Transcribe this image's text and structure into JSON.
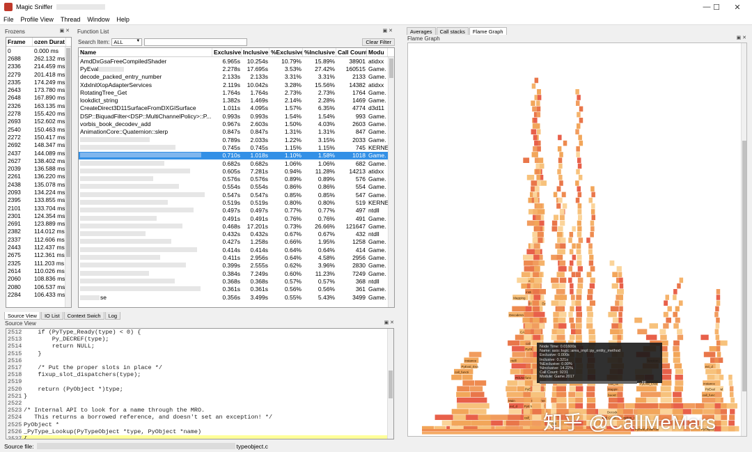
{
  "window": {
    "title": "Magic Sniffer",
    "minimize": "—",
    "maximize": "☐",
    "close": "✕"
  },
  "menu": [
    "File",
    "Profile View",
    "Thread",
    "Window",
    "Help"
  ],
  "frozens": {
    "title": "Frozens",
    "float": "▣ ✕",
    "headers": [
      "Frame",
      "ozen Durat"
    ],
    "rows": [
      [
        "0",
        "0.000 ms"
      ],
      [
        "2688",
        "262.132 ms"
      ],
      [
        "2336",
        "214.459 ms"
      ],
      [
        "2279",
        "201.418 ms"
      ],
      [
        "2335",
        "174.249 ms"
      ],
      [
        "2643",
        "173.780 ms"
      ],
      [
        "2648",
        "167.890 ms"
      ],
      [
        "2326",
        "163.135 ms"
      ],
      [
        "2278",
        "155.420 ms"
      ],
      [
        "2693",
        "152.602 ms"
      ],
      [
        "2540",
        "150.463 ms"
      ],
      [
        "2272",
        "150.417 ms"
      ],
      [
        "2692",
        "148.347 ms"
      ],
      [
        "2437",
        "144.089 ms"
      ],
      [
        "2627",
        "138.402 ms"
      ],
      [
        "2039",
        "136.588 ms"
      ],
      [
        "2261",
        "136.220 ms"
      ],
      [
        "2438",
        "135.078 ms"
      ],
      [
        "2093",
        "134.224 ms"
      ],
      [
        "2395",
        "133.855 ms"
      ],
      [
        "2101",
        "133.704 ms"
      ],
      [
        "2301",
        "124.354 ms"
      ],
      [
        "2691",
        "123.889 ms"
      ],
      [
        "2382",
        "114.012 ms"
      ],
      [
        "2337",
        "112.606 ms"
      ],
      [
        "2443",
        "112.437 ms"
      ],
      [
        "2675",
        "112.361 ms"
      ],
      [
        "2325",
        "111.203 ms"
      ],
      [
        "2614",
        "110.026 ms"
      ],
      [
        "2060",
        "108.836 ms"
      ],
      [
        "2080",
        "106.537 ms"
      ],
      [
        "2284",
        "106.433 ms"
      ]
    ]
  },
  "function_list": {
    "title": "Function List",
    "float": "▣ ✕",
    "search_label": "Search Item:",
    "search_scope": "ALL",
    "clear_filter": "Clear Filter",
    "headers": [
      "Name",
      "Exclusive",
      "Inclusive",
      "%Exclusive",
      "%Inclusive",
      "Call Count",
      "Modu"
    ],
    "rows": [
      [
        "AmdDxGsaFreeCompiledShader",
        "6.965s",
        "10.254s",
        "10.79%",
        "15.89%",
        "38901",
        "atidxx"
      ],
      [
        "PyEval",
        "2.278s",
        "17.695s",
        "3.53%",
        "27.42%",
        "160515",
        "Game."
      ],
      [
        "decode_packed_entry_number",
        "2.133s",
        "2.133s",
        "3.31%",
        "3.31%",
        "2133",
        "Game."
      ],
      [
        "XdxlnitXopAdapterServices",
        "2.119s",
        "10.042s",
        "3.28%",
        "15.56%",
        "14382",
        "atidxx"
      ],
      [
        "RotatingTree_Get",
        "1.764s",
        "1.764s",
        "2.73%",
        "2.73%",
        "1764",
        "Game."
      ],
      [
        "lookdict_string",
        "1.382s",
        "1.469s",
        "2.14%",
        "2.28%",
        "1469",
        "Game."
      ],
      [
        "CreateDirect3D11SurfaceFromDXGISurface",
        "1.011s",
        "4.095s",
        "1.57%",
        "6.35%",
        "4774",
        "d3d11"
      ],
      [
        "DSP::BiquadFilter<DSP::MultiChannelPolicy>::P...",
        "0.993s",
        "0.993s",
        "1.54%",
        "1.54%",
        "993",
        "Game."
      ],
      [
        "vorbis_book_decodev_add",
        "0.967s",
        "2.603s",
        "1.50%",
        "4.03%",
        "2603",
        "Game."
      ],
      [
        "AnimationCore::Quaternion::slerp",
        "0.847s",
        "0.847s",
        "1.31%",
        "1.31%",
        "847",
        "Game."
      ],
      [
        "",
        "0.789s",
        "2.033s",
        "1.22%",
        "3.15%",
        "2033",
        "Game."
      ],
      [
        "",
        "0.745s",
        "0.745s",
        "1.15%",
        "1.15%",
        "745",
        "KERNE"
      ],
      [
        "",
        "0.710s",
        "1.018s",
        "1.10%",
        "1.58%",
        "1018",
        "Game."
      ],
      [
        "",
        "0.682s",
        "0.682s",
        "1.06%",
        "1.06%",
        "682",
        "Game."
      ],
      [
        "",
        "0.605s",
        "7.281s",
        "0.94%",
        "11.28%",
        "14213",
        "atidxx"
      ],
      [
        "",
        "0.576s",
        "0.576s",
        "0.89%",
        "0.89%",
        "576",
        "Game."
      ],
      [
        "",
        "0.554s",
        "0.554s",
        "0.86%",
        "0.86%",
        "554",
        "Game."
      ],
      [
        "",
        "0.547s",
        "0.547s",
        "0.85%",
        "0.85%",
        "547",
        "Game."
      ],
      [
        "",
        "0.519s",
        "0.519s",
        "0.80%",
        "0.80%",
        "519",
        "KERNE"
      ],
      [
        "",
        "0.497s",
        "0.497s",
        "0.77%",
        "0.77%",
        "497",
        "ntdll"
      ],
      [
        "",
        "0.491s",
        "0.491s",
        "0.76%",
        "0.76%",
        "491",
        "Game."
      ],
      [
        "",
        "0.468s",
        "17.201s",
        "0.73%",
        "26.66%",
        "121647",
        "Game."
      ],
      [
        "",
        "0.432s",
        "0.432s",
        "0.67%",
        "0.67%",
        "432",
        "ntdll"
      ],
      [
        "",
        "0.427s",
        "1.258s",
        "0.66%",
        "1.95%",
        "1258",
        "Game."
      ],
      [
        "",
        "0.414s",
        "0.414s",
        "0.64%",
        "0.64%",
        "414",
        "Game."
      ],
      [
        "",
        "0.411s",
        "2.956s",
        "0.64%",
        "4.58%",
        "2956",
        "Game."
      ],
      [
        "",
        "0.399s",
        "2.555s",
        "0.62%",
        "3.96%",
        "2830",
        "Game."
      ],
      [
        "",
        "0.384s",
        "7.249s",
        "0.60%",
        "11.23%",
        "7249",
        "Game."
      ],
      [
        "",
        "0.368s",
        "0.368s",
        "0.57%",
        "0.57%",
        "368",
        "ntdll"
      ],
      [
        "",
        "0.361s",
        "0.361s",
        "0.56%",
        "0.56%",
        "361",
        "Game."
      ],
      [
        "se",
        "0.356s",
        "3.499s",
        "0.55%",
        "5.43%",
        "3499",
        "Game."
      ]
    ]
  },
  "bottom_tabs": [
    "Source View",
    "IO List",
    "Context Swich",
    "Log"
  ],
  "source_view": {
    "title": "Source View",
    "float": "▣ ✕",
    "lines": [
      [
        "2512",
        "    if (PyType_Ready(type) < 0) {"
      ],
      [
        "2513",
        "        Py_DECREF(type);"
      ],
      [
        "2514",
        "        return NULL;"
      ],
      [
        "2515",
        "    }"
      ],
      [
        "2516",
        ""
      ],
      [
        "2517",
        "    /* Put the proper slots in place */"
      ],
      [
        "2518",
        "    fixup_slot_dispatchers(type);"
      ],
      [
        "2519",
        ""
      ],
      [
        "2520",
        "    return (PyObject *)type;"
      ],
      [
        "2521",
        "}"
      ],
      [
        "2522",
        ""
      ],
      [
        "2523",
        "/* Internal API to look for a name through the MRO."
      ],
      [
        "2524",
        "   This returns a borrowed reference, and doesn't set an exception! */"
      ],
      [
        "2525",
        "PyObject *"
      ],
      [
        "2526",
        "_PyType_Lookup(PyTypeObject *type, PyObject *name)"
      ],
      [
        "2527",
        "{"
      ]
    ]
  },
  "status": {
    "label": "Source file:",
    "file_suffix": "typeobject.c"
  },
  "right_tabs": [
    "Averages",
    "Call stacks",
    "Flame Graph"
  ],
  "flame": {
    "title": "Flame Graph",
    "float": "▣ ✕",
    "labels": [
      "call_fun",
      "PyEval_EvalFrame",
      "PyEval_EvalCode",
      "function_call",
      "PyObject_Call",
      "call_function",
      "PyEval_EvalCodeEx",
      "instancemethod_c",
      "ext_d",
      "Main",
      "BaseThreadInitThunk",
      "RtlUserThreadStart",
      "ntdll",
      "CAIoEngine::Perfor",
      "DecodeVo",
      "boost::asio::detail",
      "Mapping"
    ],
    "tooltip": [
      "Node Time: 0.01600s",
      "Name: asio::logic::area_impl::py_entity_method",
      "Exclusive: 0.000s",
      "Inclusive: 0.321s",
      "%Exclusive: 0.00%",
      "%Inclusive: 14.22%",
      "Call Count: 9231",
      "Module: Game.2017"
    ],
    "tooltip_path": "...pp"
  },
  "watermark": "知乎 @CallMeMars"
}
